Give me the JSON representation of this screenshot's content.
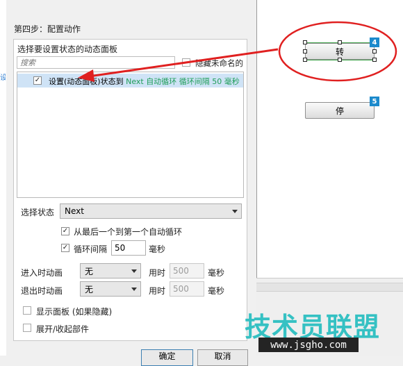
{
  "dialog": {
    "step_title": "第四步：配置动作",
    "panel_label": "选择要设置状态的动态面板",
    "search_placeholder": "搜索",
    "hide_unnamed_label": "隐藏未命名的",
    "tree_item": {
      "checked": "✓",
      "prefix": "设置(动态面板)状态到",
      "highlight": "Next 自动循环 循环间隔 50 毫秒"
    },
    "select_state_label": "选择状态",
    "select_state_value": "Next",
    "loop_checkbox_label": "从最后一个到第一个自动循环",
    "loop_checkbox_mark": "✓",
    "interval_checkbox_label": "循环间隔",
    "interval_checkbox_mark": "✓",
    "interval_value": "50",
    "interval_unit": "毫秒",
    "enter_anim_label": "进入时动画",
    "enter_anim_value": "无",
    "enter_time_label": "用时",
    "enter_time_value": "500",
    "enter_time_unit": "毫秒",
    "exit_anim_label": "退出时动画",
    "exit_anim_value": "无",
    "exit_time_label": "用时",
    "exit_time_value": "500",
    "exit_time_unit": "毫秒",
    "show_panel_label": "显示面板 (如果隐藏)",
    "expand_label": "展开/收起部件",
    "ok_label": "确定",
    "cancel_label": "取消"
  },
  "canvas": {
    "turn_button_label": "转",
    "turn_badge": "4",
    "stop_button_label": "停",
    "stop_badge": "5"
  },
  "watermark": {
    "text": "技术员联盟",
    "url": "www.jsgho.com"
  },
  "left_strip_text": "设",
  "colors": {
    "accent_green": "#1e9d58",
    "selection_blue": "#cfe3f6",
    "badge_blue": "#1c8acc",
    "annotation_red": "#e02020",
    "watermark_cyan": "#35c1c3"
  }
}
